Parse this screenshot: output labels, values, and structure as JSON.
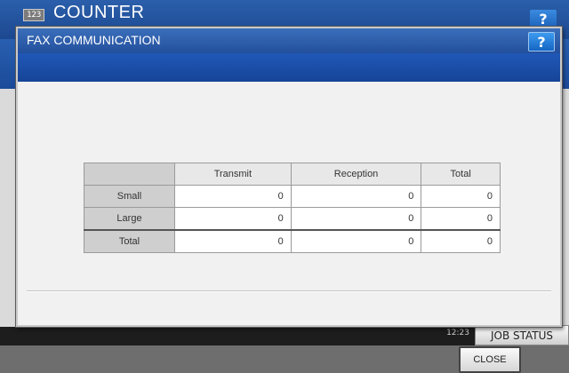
{
  "background_screen": {
    "icon_text": "123",
    "title": "COUNTER",
    "help_label": "?",
    "clock": [
      "",
      "12:23"
    ],
    "job_status_label": "JOB STATUS"
  },
  "dialog": {
    "title": "FAX COMMUNICATION",
    "help_label": "?",
    "table": {
      "columns": [
        "Transmit",
        "Reception",
        "Total"
      ],
      "rows": [
        {
          "label": "Small",
          "values": [
            "0",
            "0",
            "0"
          ]
        },
        {
          "label": "Large",
          "values": [
            "0",
            "0",
            "0"
          ]
        },
        {
          "label": "Total",
          "values": [
            "0",
            "0",
            "0"
          ]
        }
      ]
    },
    "close_label": "CLOSE"
  },
  "colors": {
    "title_bar": "#234f9c",
    "body": "#f1f1f1",
    "footer": "#1d1d1d"
  }
}
